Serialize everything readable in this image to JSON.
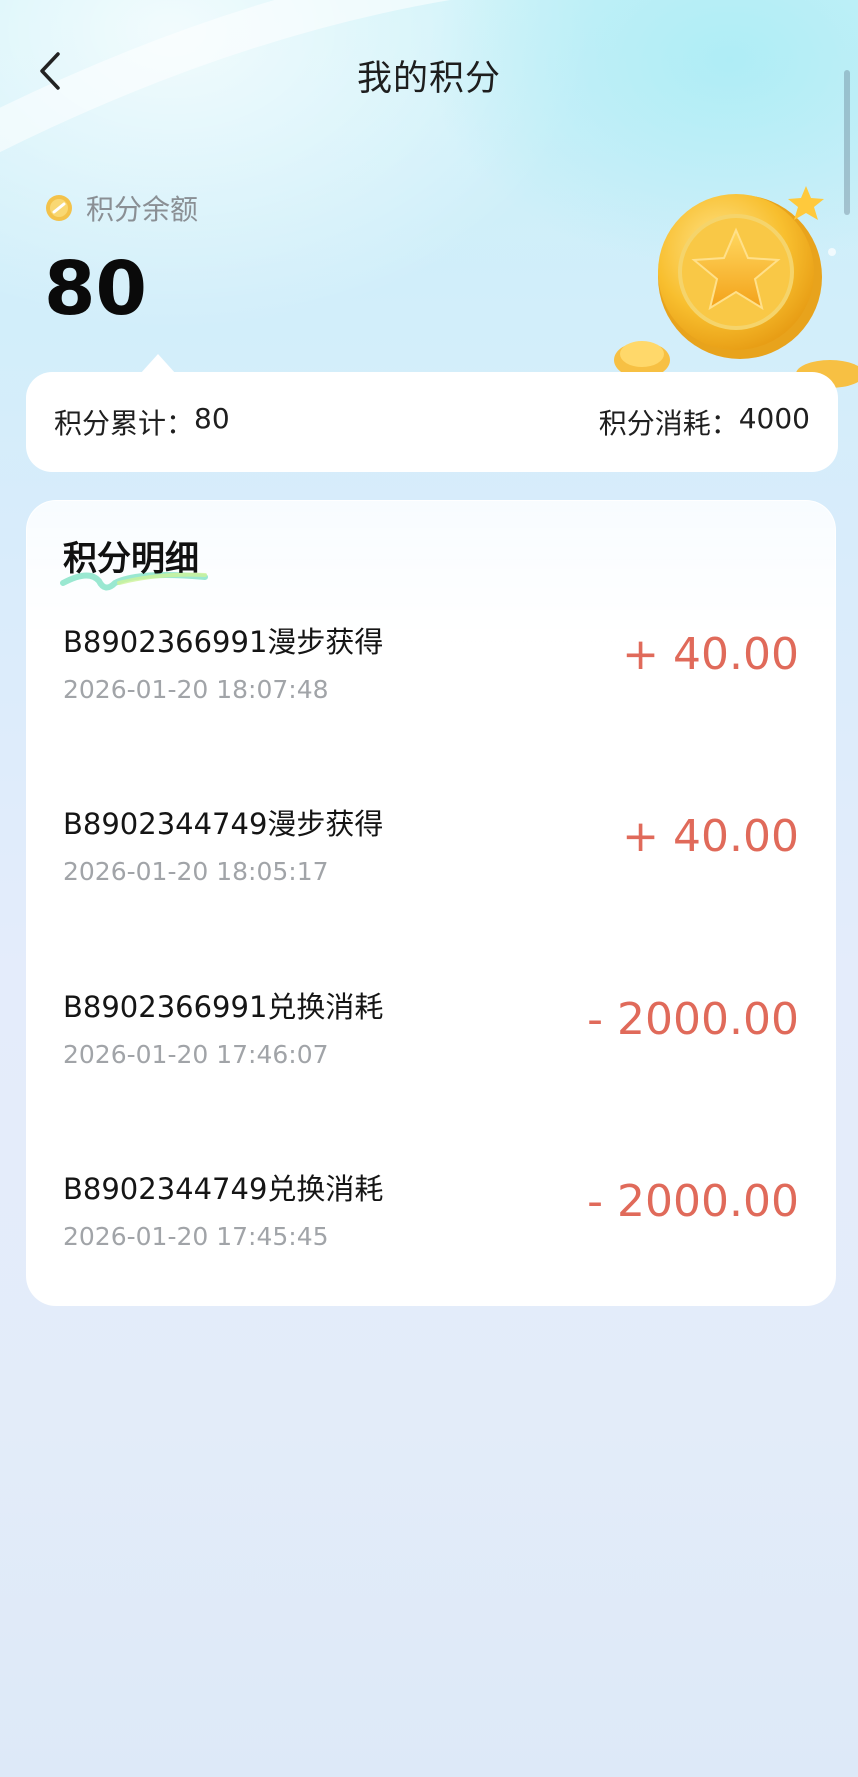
{
  "header": {
    "title": "我的积分"
  },
  "balance": {
    "label": "积分余额",
    "value": "80"
  },
  "stats": {
    "total_label": "积分累计：",
    "total_value": "80",
    "consumed_label": "积分消耗：",
    "consumed_value": "4000"
  },
  "details": {
    "title": "积分明细",
    "records": [
      {
        "name": "B8902366991漫步获得",
        "time": "2026-01-20 18:07:48",
        "amount": "+ 40.00"
      },
      {
        "name": "B8902344749漫步获得",
        "time": "2026-01-20 18:05:17",
        "amount": "+ 40.00"
      },
      {
        "name": "B8902366991兑换消耗",
        "time": "2026-01-20 17:46:07",
        "amount": "- 2000.00"
      },
      {
        "name": "B8902344749兑换消耗",
        "time": "2026-01-20 17:45:45",
        "amount": "- 2000.00"
      }
    ]
  },
  "colors": {
    "amount": "#e06a5a",
    "accent_underline": "#7fe0c8"
  },
  "icons": {
    "back": "chevron-left-icon",
    "coin": "coin-icon",
    "decoration": "gold-coin-star-illustration"
  }
}
